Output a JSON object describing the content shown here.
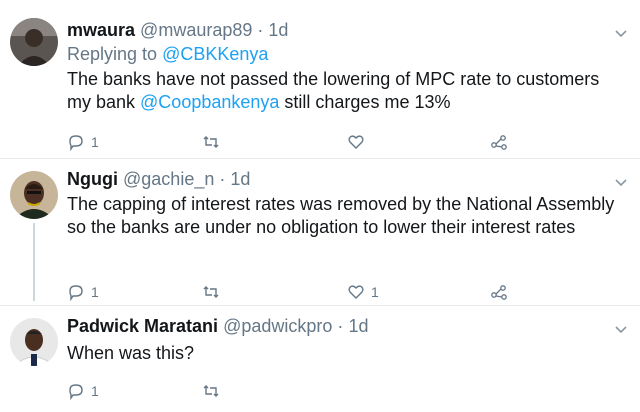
{
  "tweets": [
    {
      "name": "mwaura",
      "handle": "@mwaurap89",
      "dot": "·",
      "time": "1d",
      "replying_prefix": "Replying to ",
      "replying_to": "@CBKKenya",
      "text_part1": "The banks have not passed the lowering of MPC rate to customers my bank ",
      "text_mention": "@Coopbankenya",
      "text_part2": "  still charges me 13%",
      "reply_count": "1",
      "retweet_count": "",
      "like_count": ""
    },
    {
      "name": "Ngugi",
      "handle": "@gachie_n",
      "dot": "·",
      "time": "1d",
      "text": "The capping of interest rates was removed by the National Assembly so the banks are under no obligation to lower their interest rates",
      "reply_count": "1",
      "retweet_count": "",
      "like_count": "1"
    },
    {
      "name": "Padwick Maratani",
      "handle": "@padwickpro",
      "dot": "·",
      "time": "1d",
      "text": "When was this?",
      "reply_count": "1",
      "retweet_count": "",
      "like_count": ""
    }
  ],
  "icons": {
    "reply": "reply-icon",
    "retweet": "retweet-icon",
    "like": "like-icon",
    "share": "share-icon",
    "more": "chevron-down-icon"
  },
  "colors": {
    "link": "#1da1f2",
    "secondary": "#657786",
    "text": "#14171a",
    "divider": "#e6ecf0",
    "thread_line": "#ccd6dd"
  }
}
